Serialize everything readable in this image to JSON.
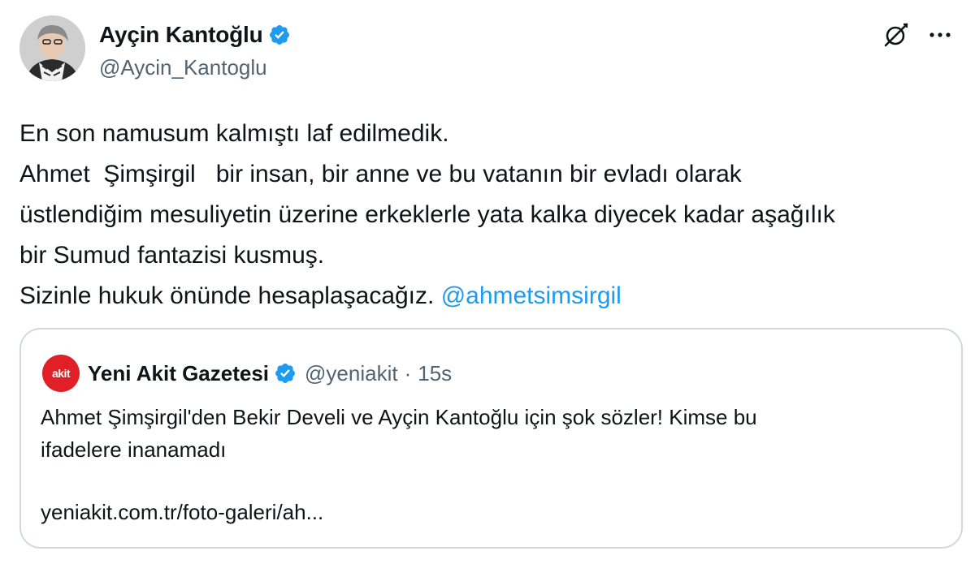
{
  "author": {
    "display_name": "Ayçin Kantoğlu",
    "handle": "@Aycin_Kantoglu",
    "verified": true
  },
  "icons": {
    "avatar": "profile-photo",
    "verified": "verified-badge-icon",
    "grok": "grok-icon",
    "more": "more-icon"
  },
  "tweet": {
    "lines": [
      "En son namusum kalmıştı laf edilmedik.",
      "Ahmet  Şimşirgil   bir insan, bir anne ve bu vatanın bir evladı olarak",
      "üstlendiğim mesuliyetin üzerine erkeklerle yata kalka diyecek kadar aşağılık",
      "bir Sumud fantazisi kusmuş.",
      "Sizinle hukuk önünde hesaplaşacağız. "
    ],
    "mention": "@ahmetsimsirgil"
  },
  "quote": {
    "logo_text": "akit",
    "display_name": "Yeni Akit Gazetesi",
    "handle": "@yeniakit",
    "separator": "·",
    "time": "15s",
    "text_line1": "Ahmet Şimşirgil'den Bekir Develi ve Ayçin Kantoğlu için şok sözler! Kimse bu",
    "text_line2": "ifadelere inanamadı",
    "link": "yeniakit.com.tr/foto-galeri/ah..."
  },
  "colors": {
    "accent": "#1d9bf0",
    "secondary_text": "#536471",
    "border": "#cfd9de",
    "akit_red": "#e01f26"
  }
}
